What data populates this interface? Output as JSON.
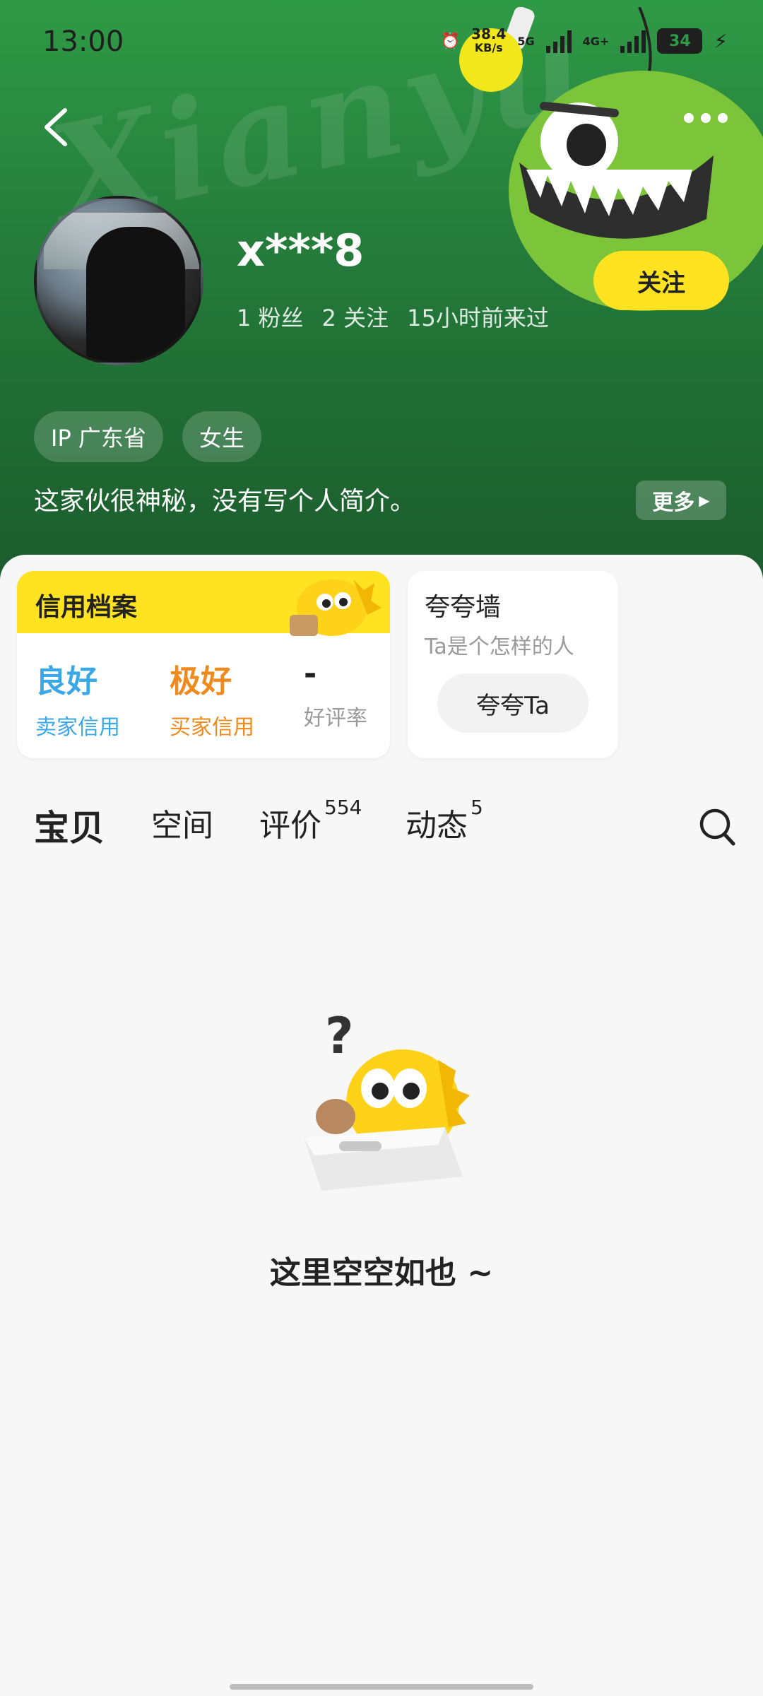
{
  "status_bar": {
    "time": "13:00",
    "network_speed": "38.4",
    "network_speed_unit": "KB/s",
    "signal_1": "5G",
    "signal_2": "4G+",
    "battery": "34"
  },
  "profile": {
    "username": "x***8",
    "followers": "1 粉丝",
    "following": "2 关注",
    "last_seen": "15小时前来过",
    "follow_button": "关注",
    "tags": [
      "IP 广东省",
      "女生"
    ],
    "bio": "这家伙很神秘，没有写个人简介。",
    "more_button": "更多"
  },
  "credit": {
    "title": "信用档案",
    "seller_value": "良好",
    "seller_label": "卖家信用",
    "buyer_value": "极好",
    "buyer_label": "买家信用",
    "rate_value": "-",
    "rate_label": "好评率"
  },
  "praise": {
    "title": "夸夸墙",
    "subtitle": "Ta是个怎样的人",
    "button": "夸夸Ta"
  },
  "tabs": [
    {
      "label": "宝贝",
      "count": ""
    },
    {
      "label": "空间",
      "count": ""
    },
    {
      "label": "评价",
      "count": "554"
    },
    {
      "label": "动态",
      "count": "5"
    }
  ],
  "empty_state": {
    "text": "这里空空如也 ~"
  },
  "colors": {
    "accent_yellow": "#ffe220",
    "header_green": "#2f9a46",
    "seller_blue": "#3aa8e6",
    "buyer_orange": "#ee8a1e"
  }
}
